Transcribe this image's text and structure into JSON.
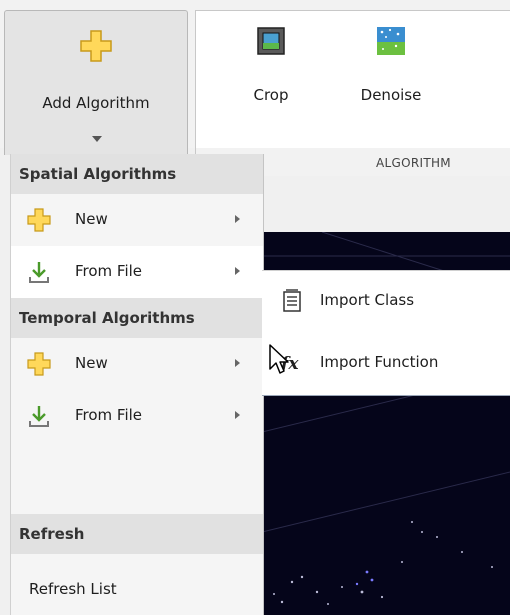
{
  "toolstrip": {
    "add_algorithm_label": "Add Algorithm",
    "tools": [
      {
        "label": "Crop",
        "icon": "crop-icon"
      },
      {
        "label": "Denoise",
        "icon": "denoise-icon"
      }
    ],
    "section_label": "ALGORITHM"
  },
  "menu": {
    "sections": [
      {
        "heading": "Spatial Algorithms",
        "items": [
          {
            "label": "New",
            "icon": "plus-icon"
          },
          {
            "label": "From File",
            "icon": "download-icon"
          }
        ]
      },
      {
        "heading": "Temporal Algorithms",
        "items": [
          {
            "label": "New",
            "icon": "plus-icon"
          },
          {
            "label": "From File",
            "icon": "download-icon"
          }
        ]
      },
      {
        "heading": "Refresh",
        "items": [
          {
            "label": "Refresh List"
          }
        ]
      }
    ]
  },
  "submenu": {
    "items": [
      {
        "label": "Import Class",
        "icon": "class-icon"
      },
      {
        "label": "Import Function",
        "icon": "fx-icon"
      }
    ]
  },
  "colors": {
    "plus_fill": "#ffd85a",
    "plus_stroke": "#c89a1a",
    "download_arrow": "#4a9a2a",
    "canvas": "#05051a"
  }
}
